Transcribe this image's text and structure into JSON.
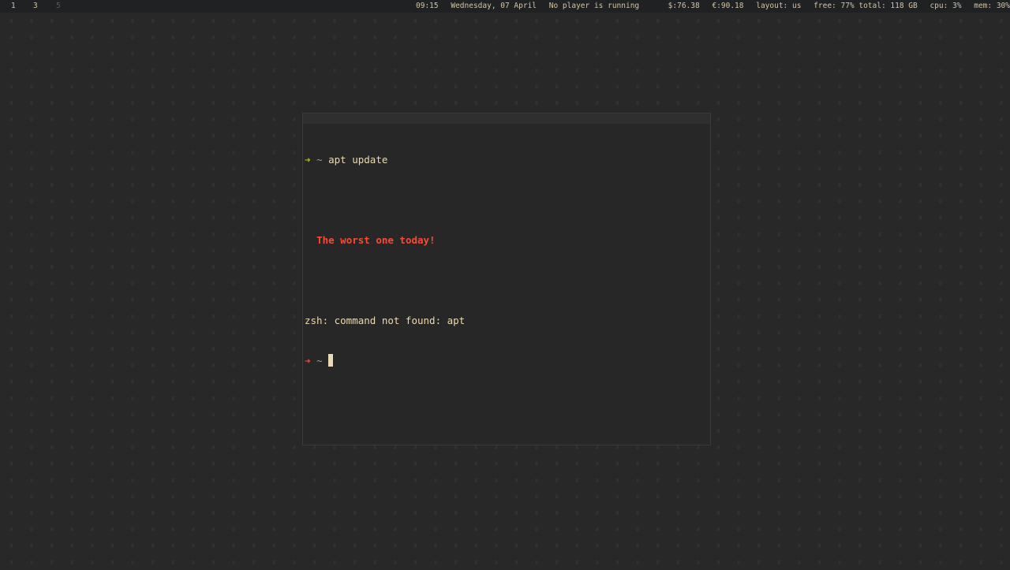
{
  "statusbar": {
    "workspaces": [
      "1",
      "3",
      "5"
    ],
    "time": "09:15",
    "date": "Wednesday, 07 April",
    "player": "No player is running",
    "usd_rate": "$:76.38",
    "eur_rate": "€:90.18",
    "layout": "layout: us",
    "disk": "free: 77% total: 118 GB",
    "cpu": "cpu:  3%",
    "mem": "mem: 30%"
  },
  "terminal": {
    "prompt_arrow": "➜",
    "prompt_dir": "~",
    "command": "apt update",
    "insult": "The worst one today!",
    "error": "zsh: command not found: apt"
  },
  "colors": {
    "background": "#282828",
    "pattern": "#3a3a3a",
    "bar_background": "#1f2122",
    "foreground": "#ebdbb2",
    "prompt_success": "#b8bb26",
    "prompt_error": "#fb4934"
  },
  "icons": {
    "wallpaper": "x-pattern",
    "cursor": "block-cursor"
  }
}
